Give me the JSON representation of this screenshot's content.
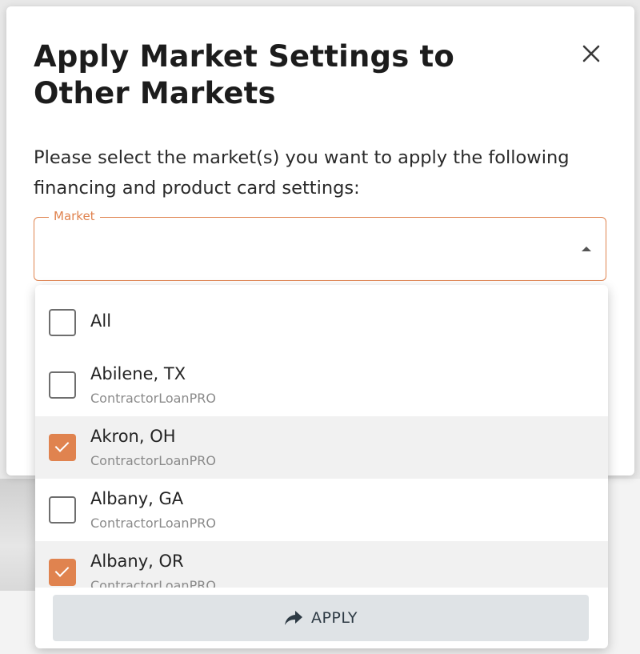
{
  "modal": {
    "title": "Apply Market Settings to Other Markets",
    "description": "Please select the market(s) you want to apply the following financing and product card settings:",
    "close_icon": "close-icon"
  },
  "market_field": {
    "label": "Market",
    "value": ""
  },
  "options": [
    {
      "name": "All",
      "sub": "",
      "checked": false
    },
    {
      "name": "Abilene, TX",
      "sub": "ContractorLoanPRO",
      "checked": false
    },
    {
      "name": "Akron, OH",
      "sub": "ContractorLoanPRO",
      "checked": true
    },
    {
      "name": "Albany, GA",
      "sub": "ContractorLoanPRO",
      "checked": false
    },
    {
      "name": "Albany, OR",
      "sub": "ContractorLoanPRO",
      "checked": true
    }
  ],
  "apply_button": {
    "label": "APPLY",
    "icon": "share-arrow-icon"
  },
  "colors": {
    "accent": "#e0834f",
    "apply_bg": "#dfe3e6",
    "selected_row": "#f1f1f1"
  }
}
